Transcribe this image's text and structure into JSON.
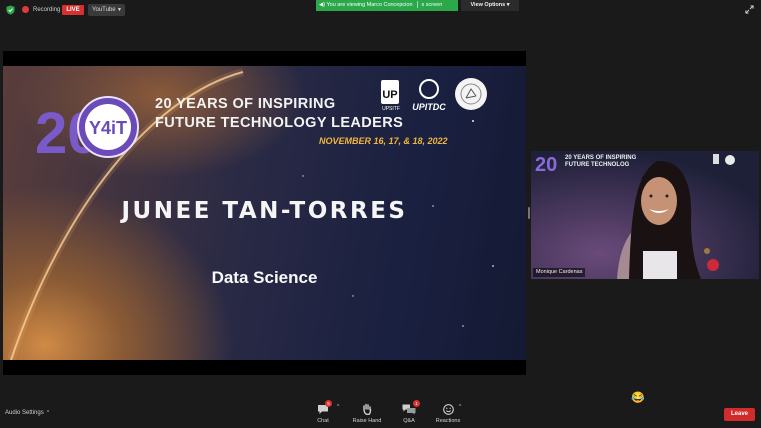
{
  "topbar": {
    "recording_label": "Recording",
    "live_label": "LIVE",
    "stream_target": "YouTube",
    "viewing_text": "You are viewing Marco Concepcion",
    "viewing_suffix": "s screen",
    "view_options_label": "View Options"
  },
  "slide": {
    "badge_text": "Y4iT",
    "badge_number": "20",
    "headline_line1": "20 YEARS OF INSPIRING",
    "headline_line2": "FUTURE TECHNOLOGY LEADERS",
    "dates": "NOVEMBER 16, 17, & 18, 2022",
    "logo_labels": [
      "UP",
      "UPSITF",
      "UPITDC"
    ],
    "speaker_name": "JUNEE TAN-TORRES",
    "topic": "Data Science"
  },
  "video_tile": {
    "title_line1": "20 YEARS OF INSPIRING",
    "title_line2": "FUTURE TECHNOLOG",
    "badge_number": "20",
    "participant_name": "Monique Cardenas"
  },
  "bottombar": {
    "audio_settings_label": "Audio Settings",
    "controls": [
      {
        "label": "Chat",
        "badge": "5"
      },
      {
        "label": "Raise Hand"
      },
      {
        "label": "Q&A",
        "badge": "1"
      },
      {
        "label": "Reactions"
      }
    ],
    "leave_label": "Leave"
  },
  "colors": {
    "live_red": "#d63030",
    "banner_green": "#2aa84a",
    "date_gold": "#f2b63c",
    "leave_red": "#d12b2b"
  },
  "icons": [
    "shield-icon",
    "record-icon",
    "expand-icon",
    "chat-icon",
    "hand-icon",
    "qa-icon",
    "reactions-icon",
    "laugh-emoji-icon"
  ]
}
